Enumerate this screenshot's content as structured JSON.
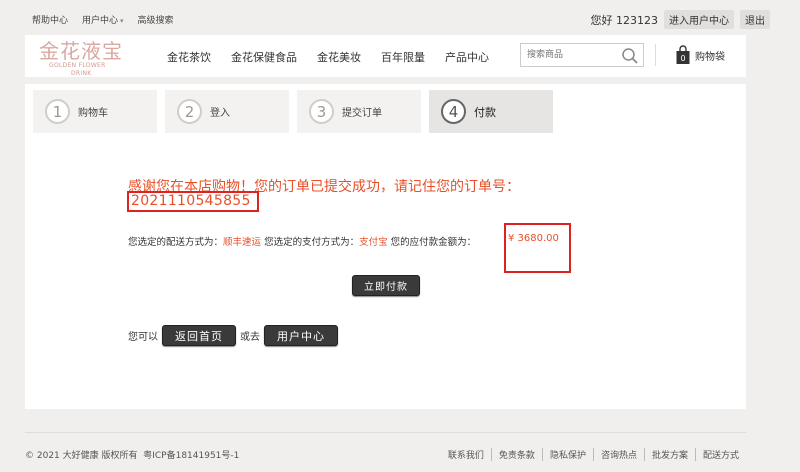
{
  "topbar": {
    "help": "帮助中心",
    "user_center": "用户中心",
    "advanced_search": "高级搜索",
    "greeting": "您好 123123",
    "enter_user_center": "进入用户中心",
    "logout": "退出"
  },
  "header": {
    "logo_cn": "金花液宝",
    "logo_en_line1": "GOLDEN FLOWER",
    "logo_en_line2": "DRINK",
    "nav": [
      "金花茶饮",
      "金花保健食品",
      "金花美妆",
      "百年限量",
      "产品中心"
    ],
    "search_placeholder": "搜索商品",
    "cart_count": "0",
    "cart_label": "购物袋"
  },
  "steps": [
    {
      "num": "1",
      "label": "购物车"
    },
    {
      "num": "2",
      "label": "登入"
    },
    {
      "num": "3",
      "label": "提交订单"
    },
    {
      "num": "4",
      "label": "付款"
    }
  ],
  "order": {
    "thanks": "感谢您在本店购物！您的订单已提交成功，请记住您的订单号：",
    "order_no": "2021110545855",
    "shipping_label": "您选定的配送方式为：",
    "shipping_value": "顺丰速运",
    "payment_label": "您选定的支付方式为：",
    "payment_value": "支付宝",
    "amount_label": "您的应付款金额为：",
    "amount_value": "¥ 3680.00",
    "pay_now": "立即付款",
    "you_can": "您可以",
    "back_home": "返回首页",
    "or_go": "或去",
    "user_center": "用户中心"
  },
  "footer": {
    "copyright": "© 2021 大好健康 版权所有",
    "icp": "粤ICP备18141951号-1",
    "links": [
      "联系我们",
      "免责条款",
      "隐私保护",
      "咨询热点",
      "批发方案",
      "配送方式"
    ]
  },
  "colors": {
    "accent": "#e8502a",
    "highlight_box": "#dd2222",
    "button_dark": "#3a3a3a"
  }
}
